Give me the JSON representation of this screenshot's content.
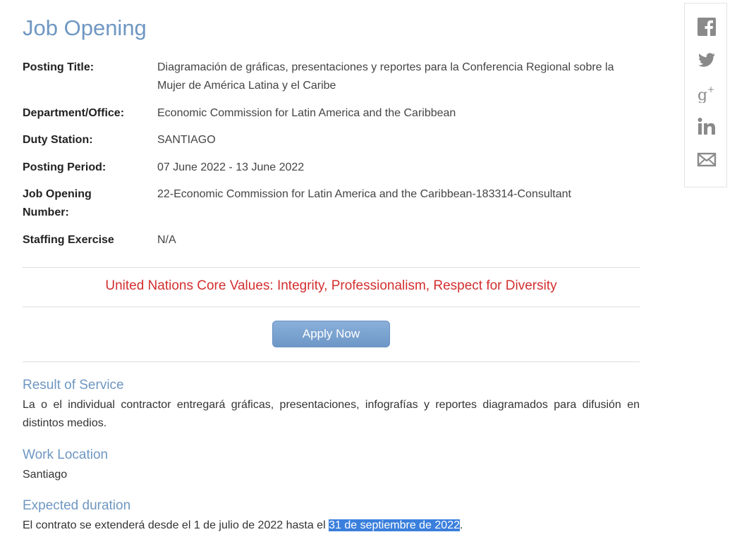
{
  "page": {
    "title": "Job Opening"
  },
  "fields": [
    {
      "label": "Posting Title:",
      "value": "Diagramación de gráficas, presentaciones y reportes para la Conferencia Regional sobre la Mujer de América Latina y el Caribe"
    },
    {
      "label": "Department/Office:",
      "value": "Economic Commission for Latin America and the Caribbean"
    },
    {
      "label": "Duty Station:",
      "value": "SANTIAGO"
    },
    {
      "label": "Posting Period:",
      "value": "07 June 2022 - 13 June 2022"
    },
    {
      "label": "Job Opening Number:",
      "value": "22-Economic Commission for Latin America and the Caribbean-183314-Consultant"
    },
    {
      "label": "Staffing Exercise",
      "value": "N/A"
    }
  ],
  "core_values": "United Nations Core Values: Integrity, Professionalism, Respect for Diversity",
  "apply_button": "Apply Now",
  "sections": {
    "result": {
      "heading": "Result of Service",
      "body": "La o el individual contractor entregará gráficas, presentaciones, infografías y reportes diagramados para difusión en distintos medios."
    },
    "location": {
      "heading": "Work Location",
      "body": "Santiago"
    },
    "duration": {
      "heading": "Expected duration",
      "body_before": "El contrato se extenderá desde el 1 de julio de 2022 hasta el ",
      "body_selected": "31 de septiembre de 2022",
      "body_after": "."
    }
  },
  "share_icons": [
    "facebook-icon",
    "twitter-icon",
    "google-plus-icon",
    "linkedin-icon",
    "email-icon"
  ],
  "colors": {
    "heading_blue": "#6f97c2",
    "core_values_red": "#d32f2f",
    "button_blue": "#7aa3d1",
    "selection_blue": "#3a7fdc",
    "icon_grey": "#8a8a8a"
  }
}
